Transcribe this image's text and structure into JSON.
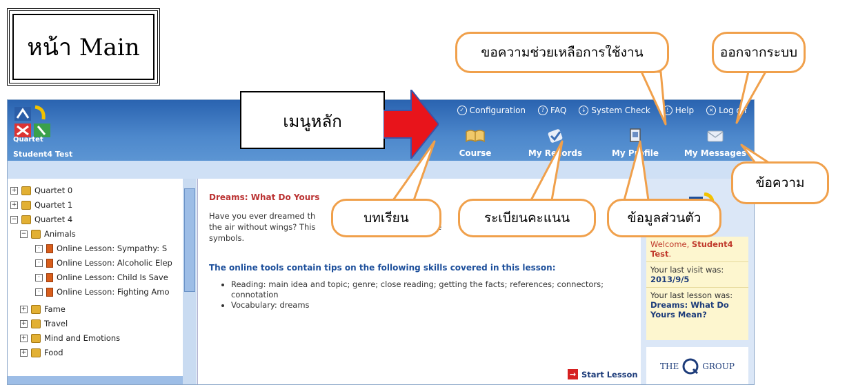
{
  "title": "หน้า Main",
  "app": {
    "brand": "Quartet",
    "student": "Student4 Test",
    "utility_menu": [
      {
        "label": "Configuration",
        "icon": "check-icon"
      },
      {
        "label": "FAQ",
        "icon": "question-icon"
      },
      {
        "label": "System Check",
        "icon": "download-icon"
      },
      {
        "label": "Help",
        "icon": "info-icon"
      },
      {
        "label": "Log off",
        "icon": "close-icon"
      }
    ],
    "nav_menu": [
      {
        "label": "Course",
        "icon": "book-icon"
      },
      {
        "label": "My Records",
        "icon": "checkmark-icon"
      },
      {
        "label": "My Profile",
        "icon": "profile-icon"
      },
      {
        "label": "My Messages",
        "icon": "envelope-icon"
      }
    ]
  },
  "tree": [
    {
      "label": "Quartet 0",
      "expander": "+"
    },
    {
      "label": "Quartet 1",
      "expander": "+"
    },
    {
      "label": "Quartet 4",
      "expander": "−"
    },
    {
      "label": "Animals",
      "expander": "−"
    },
    {
      "label": "Online Lesson: Sympathy: S",
      "expander": "·"
    },
    {
      "label": "Online Lesson: Alcoholic Elep",
      "expander": "·"
    },
    {
      "label": "Online Lesson: Child Is Save",
      "expander": "·"
    },
    {
      "label": "Online Lesson: Fighting Amo",
      "expander": "·"
    },
    {
      "label": "Fame",
      "expander": "+"
    },
    {
      "label": "Travel",
      "expander": "+"
    },
    {
      "label": "Mind and Emotions",
      "expander": "+"
    },
    {
      "label": "Food",
      "expander": "+"
    }
  ],
  "main": {
    "lesson_title": "Dreams: What Do Yours",
    "intro_line1": "Have you ever dreamed th                                            out                                                            h",
    "intro_line2": "the air without wings? This                                             me",
    "intro_line3": "symbols.",
    "skills_heading": "The online tools contain tips on the following skills covered in this lesson:",
    "skills": [
      "Reading: main idea and topic; genre; close reading; getting the facts; references; connectors; connotation",
      "Vocabulary: dreams"
    ],
    "start_lesson": "Start Lesson"
  },
  "right_panel": {
    "welcome_prefix": "Welcome, ",
    "welcome_name": "Student4 Test",
    "last_visit_label": "Your last visit was:",
    "last_visit_value": "2013/9/5",
    "last_lesson_label": "Your last lesson was:",
    "last_lesson_value": "Dreams: What Do Yours Mean?",
    "group_logo_left": "THE",
    "group_logo_right": "GROUP"
  },
  "callouts": {
    "main_menu": "เมนูหลัก",
    "help": "ขอความช่วยเหลือการใช้งาน",
    "logout": "ออกจากระบบ",
    "messages": "ข้อความ",
    "lessons": "บทเรียน",
    "records": "ระเบียนคะแนน",
    "profile": "ข้อมูลส่วนตัว"
  },
  "colors": {
    "header": "#3f78c2",
    "callout_border": "#f0a04b",
    "arrow": "#e8141b",
    "lesson_title": "#b33333",
    "welcome_card": "#fdf6cf"
  }
}
